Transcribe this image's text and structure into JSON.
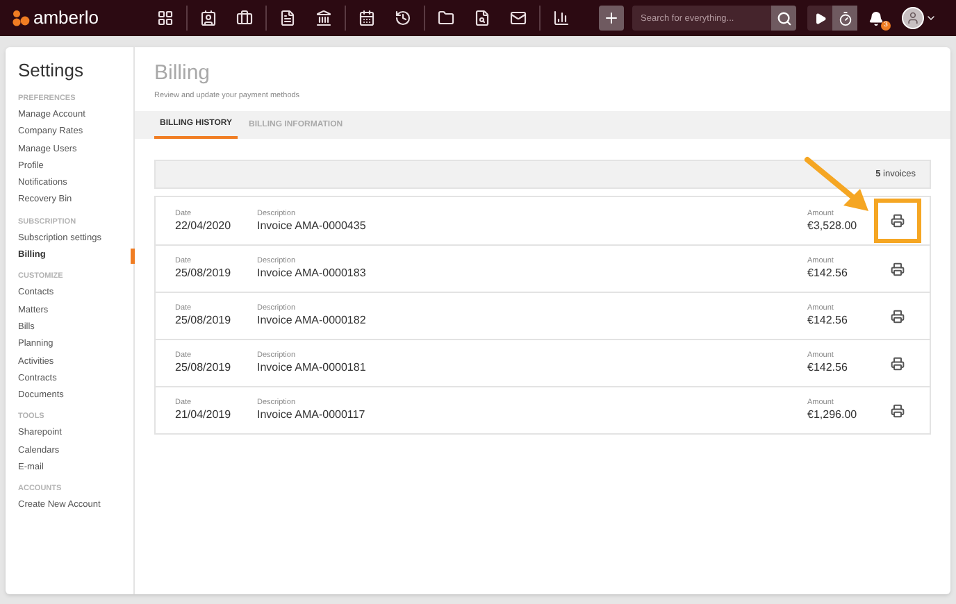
{
  "brand": "amberlo",
  "search": {
    "placeholder": "Search for everything..."
  },
  "notifications": {
    "count": "3"
  },
  "sidebar": {
    "title": "Settings",
    "sections": [
      {
        "heading": "PREFERENCES",
        "items": [
          {
            "label": "Manage Account",
            "selected": false
          },
          {
            "label": "Company Rates",
            "selected": false
          },
          {
            "label": "Manage Users",
            "selected": false
          },
          {
            "label": "Profile",
            "selected": false
          },
          {
            "label": "Notifications",
            "selected": false
          },
          {
            "label": "Recovery Bin",
            "selected": false
          }
        ]
      },
      {
        "heading": "SUBSCRIPTION",
        "items": [
          {
            "label": "Subscription settings",
            "selected": false
          },
          {
            "label": "Billing",
            "selected": true
          }
        ]
      },
      {
        "heading": "CUSTOMIZE",
        "items": [
          {
            "label": "Contacts",
            "selected": false
          },
          {
            "label": "Matters",
            "selected": false
          },
          {
            "label": "Bills",
            "selected": false
          },
          {
            "label": "Planning",
            "selected": false
          },
          {
            "label": "Activities",
            "selected": false
          },
          {
            "label": "Contracts",
            "selected": false
          },
          {
            "label": "Documents",
            "selected": false
          }
        ]
      },
      {
        "heading": "TOOLS",
        "items": [
          {
            "label": "Sharepoint",
            "selected": false
          },
          {
            "label": "Calendars",
            "selected": false
          },
          {
            "label": "E-mail",
            "selected": false
          }
        ]
      },
      {
        "heading": "ACCOUNTS",
        "items": [
          {
            "label": "Create New Account",
            "selected": false
          }
        ]
      }
    ]
  },
  "page": {
    "title": "Billing",
    "subtitle": "Review and update your payment methods"
  },
  "tabs": [
    {
      "label": "BILLING HISTORY",
      "selected": true
    },
    {
      "label": "BILLING INFORMATION",
      "selected": false
    }
  ],
  "invoices": {
    "count_text": "**5** invoices",
    "rows": [
      {
        "date_label": "Date",
        "date": "22/04/2020",
        "description_label": "Description",
        "description": "Invoice AMA-0000435",
        "amount_label": "Amount",
        "amount": "€3,528.00",
        "highlighted": true
      },
      {
        "date_label": "Date",
        "date": "25/08/2019",
        "description_label": "Description",
        "description": "Invoice AMA-0000183",
        "amount_label": "Amount",
        "amount": "€142.56",
        "highlighted": false
      },
      {
        "date_label": "Date",
        "date": "25/08/2019",
        "description_label": "Description",
        "description": "Invoice AMA-0000182",
        "amount_label": "Amount",
        "amount": "€142.56",
        "highlighted": false
      },
      {
        "date_label": "Date",
        "date": "25/08/2019",
        "description_label": "Description",
        "description": "Invoice AMA-0000181",
        "amount_label": "Amount",
        "amount": "€142.56",
        "highlighted": false
      },
      {
        "date_label": "Date",
        "date": "21/04/2019",
        "description_label": "Description",
        "description": "Invoice AMA-0000117",
        "amount_label": "Amount",
        "amount": "€1,296.00",
        "highlighted": false
      }
    ]
  }
}
